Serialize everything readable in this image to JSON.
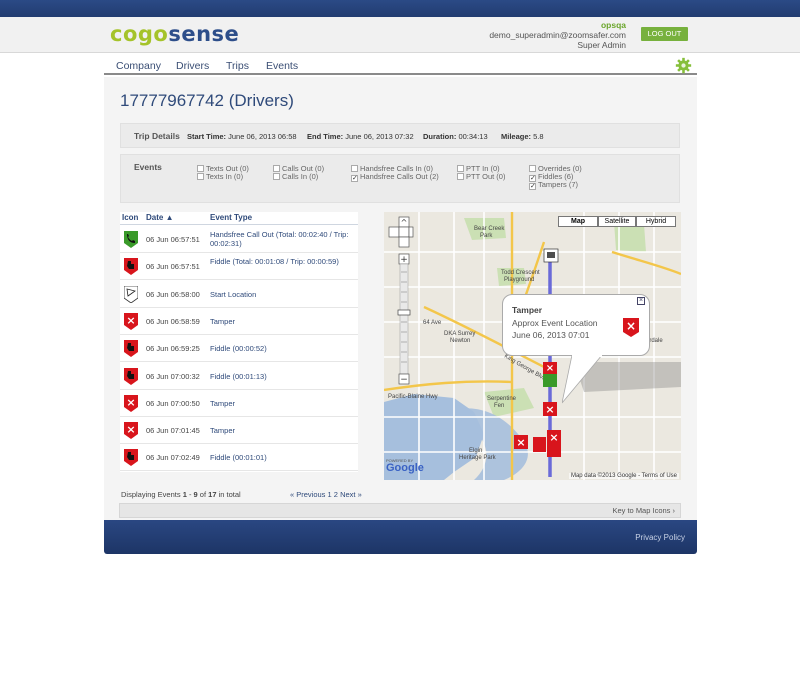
{
  "brand": {
    "part1": "cogo",
    "part2": "sense"
  },
  "user": {
    "org": "opsqa",
    "email": "demo_superadmin@zoomsafer.com",
    "role": "Super Admin",
    "logout_label": "LOG OUT"
  },
  "nav": {
    "items": [
      "Company",
      "Drivers",
      "Trips",
      "Events"
    ]
  },
  "page_title": "17777967742 (Drivers)",
  "trip": {
    "heading": "Trip Details",
    "start_label": "Start Time:",
    "start_value": "June 06, 2013 06:58",
    "end_label": "End Time:",
    "end_value": "June 06, 2013 07:32",
    "duration_label": "Duration:",
    "duration_value": "00:34:13",
    "mileage_label": "Mileage:",
    "mileage_value": "5.8"
  },
  "events_filter": {
    "heading": "Events",
    "options": [
      {
        "label": "Texts Out (0)",
        "checked": false
      },
      {
        "label": "Texts In (0)",
        "checked": false
      },
      {
        "label": "Calls Out (0)",
        "checked": false
      },
      {
        "label": "Calls In (0)",
        "checked": false
      },
      {
        "label": "Handsfree Calls In (0)",
        "checked": false
      },
      {
        "label": "Handsfree Calls Out (2)",
        "checked": true
      },
      {
        "label": "PTT In (0)",
        "checked": false
      },
      {
        "label": "PTT Out (0)",
        "checked": false
      },
      {
        "label": "Overrides (0)",
        "checked": false
      },
      {
        "label": "Fiddles (6)",
        "checked": true
      },
      {
        "label": "Tampers (7)",
        "checked": true
      }
    ],
    "check_mark": "✓"
  },
  "table": {
    "headers": {
      "icon": "Icon",
      "date": "Date ▲",
      "type": "Event Type"
    },
    "rows": [
      {
        "icon": "handsfree",
        "date": "06 Jun 06:57:51",
        "type": "Handsfree Call Out (Total: 00:02:40 / Trip: 00:02:31)"
      },
      {
        "icon": "fiddle",
        "date": "06 Jun 06:57:51",
        "type": "Fiddle (Total: 00:01:08 / Trip: 00:00:59)"
      },
      {
        "icon": "start",
        "date": "06 Jun 06:58:00",
        "type": "Start Location"
      },
      {
        "icon": "tamper",
        "date": "06 Jun 06:58:59",
        "type": "Tamper"
      },
      {
        "icon": "fiddle",
        "date": "06 Jun 06:59:25",
        "type": "Fiddle (00:00:52)"
      },
      {
        "icon": "fiddle",
        "date": "06 Jun 07:00:32",
        "type": "Fiddle (00:01:13)"
      },
      {
        "icon": "tamper",
        "date": "06 Jun 07:00:50",
        "type": "Tamper"
      },
      {
        "icon": "tamper",
        "date": "06 Jun 07:01:45",
        "type": "Tamper"
      },
      {
        "icon": "fiddle",
        "date": "06 Jun 07:02:49",
        "type": "Fiddle (00:01:01)"
      }
    ]
  },
  "paging": {
    "prefix": "Displaying Events ",
    "from": "1",
    "dash": " - ",
    "to": "9",
    "of": " of ",
    "total": "17",
    "suffix": " in total",
    "prev": "« Previous",
    "page1": "1",
    "page2": "2",
    "next": "Next »"
  },
  "key_bar": {
    "label": "Key to Map Icons ›"
  },
  "map": {
    "types": [
      "Map",
      "Satellite",
      "Hybrid"
    ],
    "popup": {
      "title": "Tamper",
      "line1": "Approx Event Location",
      "line2": "June 06, 2013 07:01",
      "close": "×"
    },
    "labels": [
      "Bear Creek Park",
      "Todd Crescent Playground",
      "64 Ave",
      "DKA Surrey Newton",
      "King George Blvd",
      "Fraser Hwy",
      "Cloverdale",
      "Serpentine Fen",
      "Elgin Heritage Park",
      "Pacific-Blaine Hwy",
      "152 St",
      "168 St",
      "176 St",
      "10",
      "15",
      "99"
    ],
    "google": "Google",
    "powered": "POWERED BY",
    "attribution": "Map data ©2013 Google - Terms of Use"
  },
  "footer": {
    "privacy": "Privacy Policy"
  },
  "colors": {
    "brand_green": "#a5c32a",
    "brand_blue": "#2d4e8a",
    "tamper_red": "#d8151c",
    "handsfree_green": "#3a9a2a"
  }
}
